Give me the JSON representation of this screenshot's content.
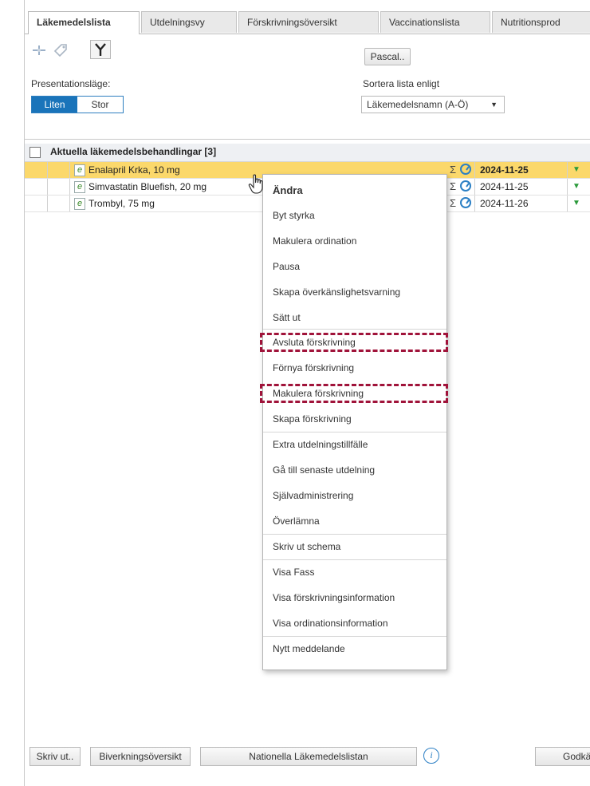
{
  "tabs": [
    {
      "label": "Läkemedelslista"
    },
    {
      "label": "Utdelningsvy"
    },
    {
      "label": "Förskrivningsöversikt"
    },
    {
      "label": "Vaccinationslista"
    },
    {
      "label": "Nutritionsprod"
    }
  ],
  "toolbar": {
    "pascal_button": "Pascal..",
    "presentation_label": "Presentationsläge:",
    "mode_small": "Liten",
    "mode_large": "Stor",
    "sort_label": "Sortera lista enligt",
    "sort_value": "Läkemedelsnamn (A-Ö)"
  },
  "list": {
    "group_title": "Aktuella läkemedelsbehandlingar [3]",
    "rows": [
      {
        "name": "Enalapril Krka, 10 mg",
        "date": "2024-11-25"
      },
      {
        "name": "Simvastatin Bluefish, 20 mg",
        "date": "2024-11-25"
      },
      {
        "name": "Trombyl, 75 mg",
        "date": "2024-11-26"
      }
    ],
    "sigma": "Σ"
  },
  "context_menu": {
    "items": [
      "Ändra",
      "Byt styrka",
      "Makulera ordination",
      "Pausa",
      "Skapa överkänslighetsvarning",
      "Sätt ut",
      "Avsluta förskrivning",
      "Förnya förskrivning",
      "Makulera förskrivning",
      "Skapa förskrivning",
      "Extra utdelningstillfälle",
      "Gå till senaste utdelning",
      "Självadministrering",
      "Överlämna",
      "Skriv ut schema",
      "Visa Fass",
      "Visa förskrivningsinformation",
      "Visa ordinationsinformation",
      "Nytt meddelande"
    ],
    "highlight_color": "#a0133a"
  },
  "bottom_bar": {
    "print": "Skriv ut..",
    "side_effects": "Biverkningsöversikt",
    "national_list": "Nationella Läkemedelslistan",
    "info_icon": "i",
    "approve": "Godkän"
  },
  "colors": {
    "selected_row": "#fbd86b",
    "accent": "#1a74ba"
  }
}
